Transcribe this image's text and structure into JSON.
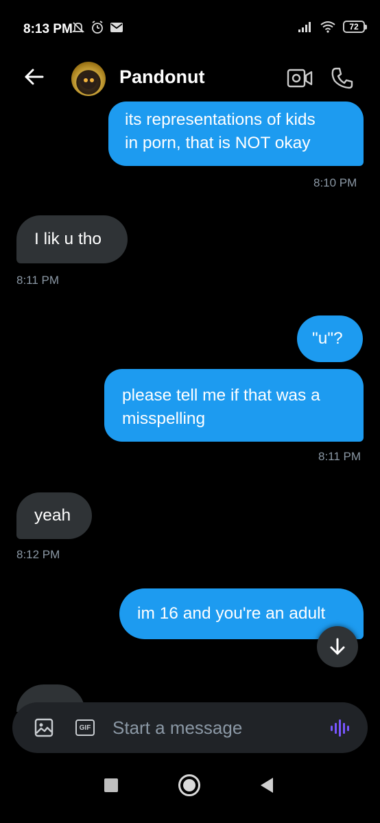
{
  "status_bar": {
    "time": "8:13 PM",
    "battery": "72"
  },
  "header": {
    "back_icon": "arrow-left-icon",
    "contact_name": "Pandonut",
    "video_icon": "video-call-icon",
    "call_icon": "phone-icon"
  },
  "messages": [
    {
      "side": "sent",
      "text": "its representations of kids\nin porn, that is NOT okay",
      "time": "8:10 PM"
    },
    {
      "side": "received",
      "text": "I lik u tho",
      "time": "8:11 PM"
    },
    {
      "side": "sent",
      "text": "\"u\"?"
    },
    {
      "side": "sent",
      "text": "please tell me if that was a\nmisspelling",
      "time": "8:11 PM"
    },
    {
      "side": "received",
      "text": "yeah",
      "time": "8:12 PM"
    },
    {
      "side": "sent",
      "text": "im 16 and you're an adult"
    }
  ],
  "composer": {
    "placeholder": "Start a message",
    "image_icon": "image-icon",
    "gif_label": "GIF",
    "voice_icon": "voice-waveform-icon"
  },
  "colors": {
    "sent_bubble": "#1d9bf0",
    "received_bubble": "#2f3336",
    "background": "#000000"
  }
}
